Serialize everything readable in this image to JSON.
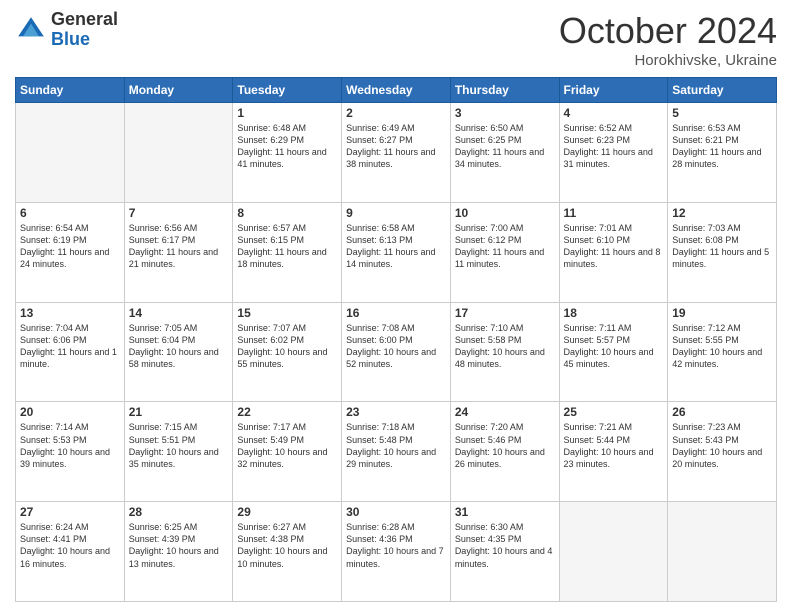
{
  "header": {
    "logo_general": "General",
    "logo_blue": "Blue",
    "month_title": "October 2024",
    "location": "Horokhivske, Ukraine"
  },
  "days_of_week": [
    "Sunday",
    "Monday",
    "Tuesday",
    "Wednesday",
    "Thursday",
    "Friday",
    "Saturday"
  ],
  "weeks": [
    [
      {
        "day": "",
        "info": ""
      },
      {
        "day": "",
        "info": ""
      },
      {
        "day": "1",
        "info": "Sunrise: 6:48 AM\nSunset: 6:29 PM\nDaylight: 11 hours and 41 minutes."
      },
      {
        "day": "2",
        "info": "Sunrise: 6:49 AM\nSunset: 6:27 PM\nDaylight: 11 hours and 38 minutes."
      },
      {
        "day": "3",
        "info": "Sunrise: 6:50 AM\nSunset: 6:25 PM\nDaylight: 11 hours and 34 minutes."
      },
      {
        "day": "4",
        "info": "Sunrise: 6:52 AM\nSunset: 6:23 PM\nDaylight: 11 hours and 31 minutes."
      },
      {
        "day": "5",
        "info": "Sunrise: 6:53 AM\nSunset: 6:21 PM\nDaylight: 11 hours and 28 minutes."
      }
    ],
    [
      {
        "day": "6",
        "info": "Sunrise: 6:54 AM\nSunset: 6:19 PM\nDaylight: 11 hours and 24 minutes."
      },
      {
        "day": "7",
        "info": "Sunrise: 6:56 AM\nSunset: 6:17 PM\nDaylight: 11 hours and 21 minutes."
      },
      {
        "day": "8",
        "info": "Sunrise: 6:57 AM\nSunset: 6:15 PM\nDaylight: 11 hours and 18 minutes."
      },
      {
        "day": "9",
        "info": "Sunrise: 6:58 AM\nSunset: 6:13 PM\nDaylight: 11 hours and 14 minutes."
      },
      {
        "day": "10",
        "info": "Sunrise: 7:00 AM\nSunset: 6:12 PM\nDaylight: 11 hours and 11 minutes."
      },
      {
        "day": "11",
        "info": "Sunrise: 7:01 AM\nSunset: 6:10 PM\nDaylight: 11 hours and 8 minutes."
      },
      {
        "day": "12",
        "info": "Sunrise: 7:03 AM\nSunset: 6:08 PM\nDaylight: 11 hours and 5 minutes."
      }
    ],
    [
      {
        "day": "13",
        "info": "Sunrise: 7:04 AM\nSunset: 6:06 PM\nDaylight: 11 hours and 1 minute."
      },
      {
        "day": "14",
        "info": "Sunrise: 7:05 AM\nSunset: 6:04 PM\nDaylight: 10 hours and 58 minutes."
      },
      {
        "day": "15",
        "info": "Sunrise: 7:07 AM\nSunset: 6:02 PM\nDaylight: 10 hours and 55 minutes."
      },
      {
        "day": "16",
        "info": "Sunrise: 7:08 AM\nSunset: 6:00 PM\nDaylight: 10 hours and 52 minutes."
      },
      {
        "day": "17",
        "info": "Sunrise: 7:10 AM\nSunset: 5:58 PM\nDaylight: 10 hours and 48 minutes."
      },
      {
        "day": "18",
        "info": "Sunrise: 7:11 AM\nSunset: 5:57 PM\nDaylight: 10 hours and 45 minutes."
      },
      {
        "day": "19",
        "info": "Sunrise: 7:12 AM\nSunset: 5:55 PM\nDaylight: 10 hours and 42 minutes."
      }
    ],
    [
      {
        "day": "20",
        "info": "Sunrise: 7:14 AM\nSunset: 5:53 PM\nDaylight: 10 hours and 39 minutes."
      },
      {
        "day": "21",
        "info": "Sunrise: 7:15 AM\nSunset: 5:51 PM\nDaylight: 10 hours and 35 minutes."
      },
      {
        "day": "22",
        "info": "Sunrise: 7:17 AM\nSunset: 5:49 PM\nDaylight: 10 hours and 32 minutes."
      },
      {
        "day": "23",
        "info": "Sunrise: 7:18 AM\nSunset: 5:48 PM\nDaylight: 10 hours and 29 minutes."
      },
      {
        "day": "24",
        "info": "Sunrise: 7:20 AM\nSunset: 5:46 PM\nDaylight: 10 hours and 26 minutes."
      },
      {
        "day": "25",
        "info": "Sunrise: 7:21 AM\nSunset: 5:44 PM\nDaylight: 10 hours and 23 minutes."
      },
      {
        "day": "26",
        "info": "Sunrise: 7:23 AM\nSunset: 5:43 PM\nDaylight: 10 hours and 20 minutes."
      }
    ],
    [
      {
        "day": "27",
        "info": "Sunrise: 6:24 AM\nSunset: 4:41 PM\nDaylight: 10 hours and 16 minutes."
      },
      {
        "day": "28",
        "info": "Sunrise: 6:25 AM\nSunset: 4:39 PM\nDaylight: 10 hours and 13 minutes."
      },
      {
        "day": "29",
        "info": "Sunrise: 6:27 AM\nSunset: 4:38 PM\nDaylight: 10 hours and 10 minutes."
      },
      {
        "day": "30",
        "info": "Sunrise: 6:28 AM\nSunset: 4:36 PM\nDaylight: 10 hours and 7 minutes."
      },
      {
        "day": "31",
        "info": "Sunrise: 6:30 AM\nSunset: 4:35 PM\nDaylight: 10 hours and 4 minutes."
      },
      {
        "day": "",
        "info": ""
      },
      {
        "day": "",
        "info": ""
      }
    ]
  ]
}
